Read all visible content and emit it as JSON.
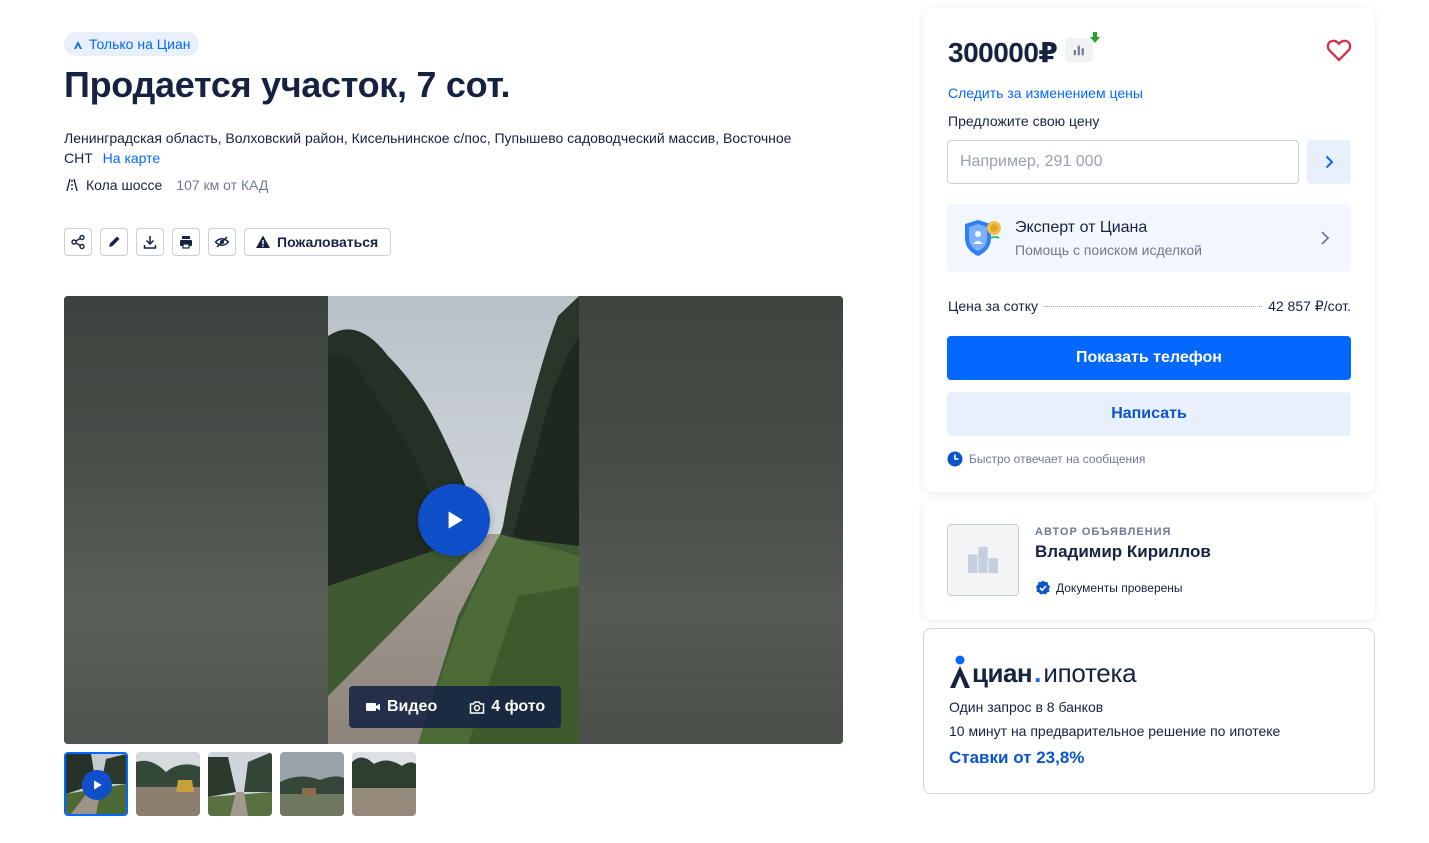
{
  "listing": {
    "badge": "Только на Циан",
    "title": "Продается участок, 7 сот.",
    "address": "Ленинградская область, Волховский район, Кисельнинское с/пос, Пупышево садоводческий массив, Восточное СНТ",
    "map_link": "На карте",
    "highway": "Кола шоссе",
    "distance": "107 км от КАД",
    "complain_label": "Пожаловаться"
  },
  "gallery": {
    "video_label": "Видео",
    "photos_label": "4 фото",
    "thumbnail_count": 5
  },
  "price_card": {
    "price": "300000₽",
    "follow_price": "Следить за изменением цены",
    "offer_label": "Предложите свою цену",
    "offer_placeholder": "Например, 291 000",
    "expert_title": "Эксперт от Циана",
    "expert_subtitle": "Помощь с поиском исделкой",
    "per_unit_label": "Цена за сотку",
    "per_unit_value": "42 857 ₽/сот.",
    "show_phone": "Показать телефон",
    "write": "Написать",
    "fast_reply": "Быстро отвечает на сообщения"
  },
  "author": {
    "caption": "АВТОР ОБЪЯВЛЕНИЯ",
    "name": "Владимир Кириллов",
    "verified": "Документы проверены"
  },
  "mortgage": {
    "logo_brand": "циан",
    "logo_dot": ".",
    "logo_product": "ипотека",
    "line1": "Один запрос в 8 банков",
    "line2": "10 минут на предварительное решение по ипотеке",
    "rates": "Ставки от 23,8%"
  },
  "colors": {
    "accent": "#0468ff",
    "text": "#152242",
    "secondary": "#707a95"
  }
}
